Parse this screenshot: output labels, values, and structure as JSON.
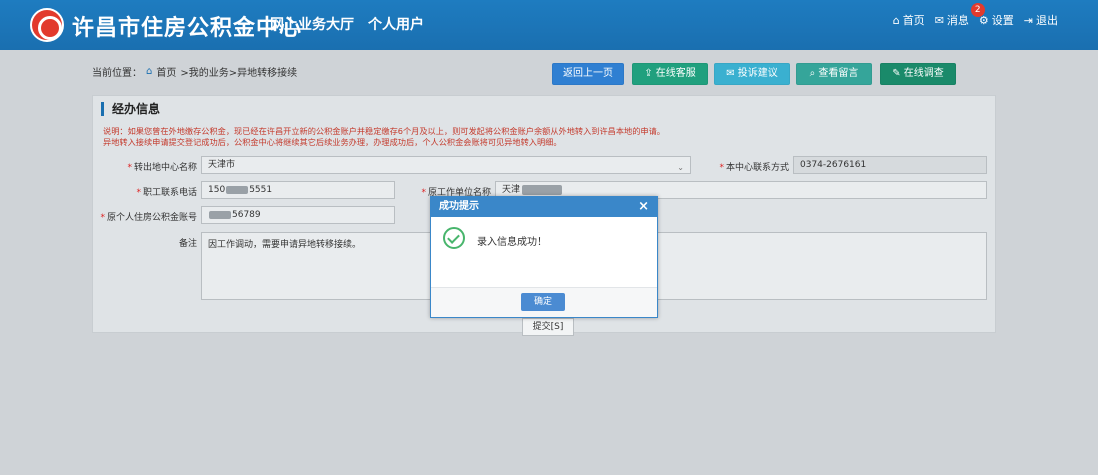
{
  "header": {
    "site_title": "许昌市住房公积金中心",
    "nav": [
      "网上业务大厅",
      "个人用户"
    ],
    "top_links": {
      "home": "首页",
      "messages": "消息",
      "messages_badge": "2",
      "settings": "设置",
      "logout": "退出"
    }
  },
  "toolbar": {
    "breadcrumb_prefix": "当前位置：",
    "breadcrumb_home": "首页",
    "breadcrumb_path": ">我的业务>异地转移接续",
    "buttons": {
      "back": "返回上一页",
      "online_service": "在线客服",
      "complaint": "投诉建议",
      "view_messages": "查看留言",
      "online_survey": "在线调查"
    }
  },
  "form": {
    "section_title": "经办信息",
    "note_line1": "说明：如果您曾在外地缴存公积金，现已经在许昌开立新的公积金账户并稳定缴存6个月及以上，则可发起将公积金账户余额从外地转入到许昌本地的申请。",
    "note_line2": "异地转入接续申请提交登记成功后，公积金中心将继续其它后续业务办理，办理成功后，个人公积金会账将可见异地转入明细。",
    "labels": {
      "transfer_center": "转出地中心名称",
      "contact": "本中心联系方式",
      "phone": "职工联系电话",
      "original_employer": "原工作单位名称",
      "original_account": "原个人住房公积金账号",
      "remark": "备注"
    },
    "values": {
      "transfer_center": "天津市",
      "contact": "0374-2676161",
      "phone_start": "150",
      "phone_end": "5551",
      "original_employer": "天津",
      "original_account_end": "56789",
      "remark": "因工作调动，需要申请异地转移接续。"
    },
    "submit": "提交[S]"
  },
  "modal": {
    "title": "成功提示",
    "close": "×",
    "message": "录入信息成功！",
    "ok": "确定"
  }
}
